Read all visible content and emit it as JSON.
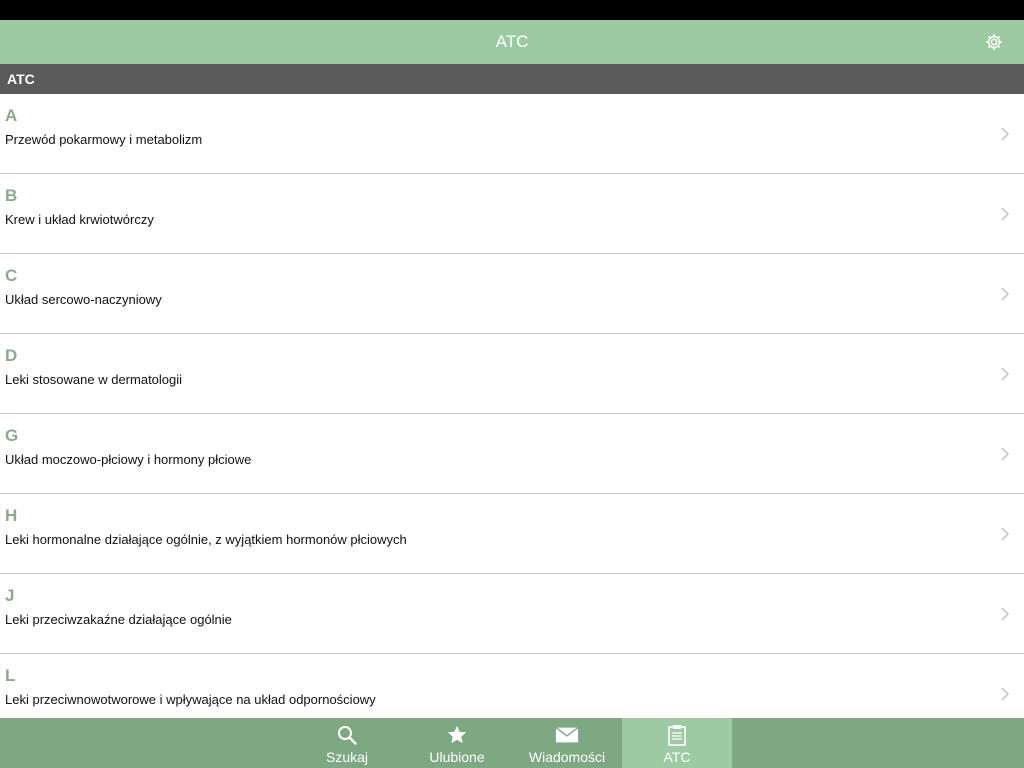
{
  "nav": {
    "title": "ATC",
    "settings_icon": "gear-icon"
  },
  "section": {
    "title": "ATC"
  },
  "items": [
    {
      "letter": "A",
      "description": "Przewód pokarmowy i metabolizm"
    },
    {
      "letter": "B",
      "description": "Krew i układ krwiotwórczy"
    },
    {
      "letter": "C",
      "description": "Układ sercowo-naczyniowy"
    },
    {
      "letter": "D",
      "description": "Leki stosowane w dermatologii"
    },
    {
      "letter": "G",
      "description": "Układ moczowo-płciowy i hormony płciowe"
    },
    {
      "letter": "H",
      "description": "Leki hormonalne działające ogólnie, z wyjątkiem hormonów płciowych"
    },
    {
      "letter": "J",
      "description": "Leki przeciwzakaźne działające ogólnie"
    },
    {
      "letter": "L",
      "description": "Leki przeciwnowotworowe i wpływające na układ odpornościowy"
    }
  ],
  "tabs": [
    {
      "label": "Szukaj",
      "icon": "search-icon",
      "active": false
    },
    {
      "label": "Ulubione",
      "icon": "star-icon",
      "active": false
    },
    {
      "label": "Wiadomości",
      "icon": "envelope-icon",
      "active": false
    },
    {
      "label": "ATC",
      "icon": "clipboard-icon",
      "active": true
    }
  ],
  "colors": {
    "nav_bar": "#9dcaa3",
    "tab_bar": "#7ea882",
    "section_header": "#5a5a5a",
    "letter": "#8aaa8e"
  }
}
